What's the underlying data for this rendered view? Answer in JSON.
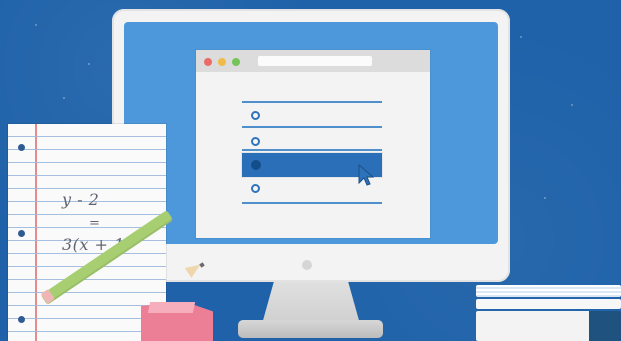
{
  "notebook": {
    "line_1": "y - 2",
    "line_2": "=",
    "line_3": "3(x + 1)"
  },
  "colors": {
    "background": "#1f62a9",
    "screen": "#4c98da",
    "browser_bar": "#dcdcdc",
    "selected_answer": "#2b6fb8",
    "notebook_paper": "#fafafa",
    "notebook_lines": "#9db8dc",
    "pencil": "#a7cf72",
    "eraser": "#ec7f95"
  },
  "icons": {
    "cursor": "mouse-pointer-icon",
    "radio": "radio-button-icon"
  }
}
